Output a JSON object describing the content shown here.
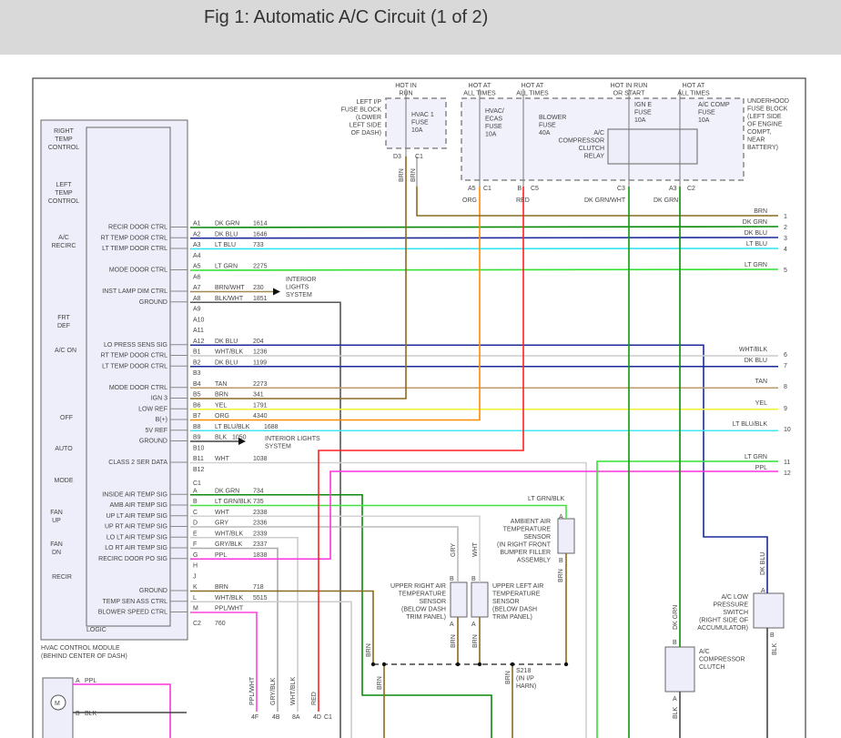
{
  "title": "Fig 1: Automatic A/C Circuit (1 of 2)",
  "wire_colors": {
    "DK GRN": "#0a8a0a",
    "DK BLU": "#1a2a9a",
    "LT BLU": "#33e4f0",
    "LT GRN": "#33e033",
    "BRN/WHT": "#a08a50",
    "BLK/WHT": "#555555",
    "WHT/BLK": "#cccccc",
    "TAN": "#b89a6a",
    "BRN": "#8a6a20",
    "YEL": "#f2f230",
    "ORG": "#ff8a00",
    "LT BLU/BLK": "#44e6f0",
    "BLK": "#444444",
    "WHT": "#d2d2d2",
    "LT GRN/BLK": "#44e044",
    "GRY": "#bbbbbb",
    "GRY/BLK": "#aaaaaa",
    "PPL": "#ff33dd",
    "PPL/WHT": "#ff44dd",
    "RED": "#ff2020",
    "DK GRN/WHT": "#0a9a0a"
  },
  "module": {
    "name": "HVAC CONTROL MODULE",
    "location": "(BEHIND CENTER OF DASH)",
    "logic_label": "LOGIC",
    "controls": [
      "RIGHT",
      "TEMP",
      "CONTROL",
      "LEFT",
      "TEMP",
      "CONTROL",
      "A/C",
      "RECIRC",
      "FRT",
      "DEF",
      "A/C ON",
      "OFF",
      "AUTO",
      "MODE",
      "FAN",
      "UP",
      "FAN",
      "DN",
      "RECIR"
    ],
    "connector_c1": "C1",
    "connector_c2": "C2",
    "c2_circuit": "760",
    "pins": [
      {
        "pin": "A1",
        "signal": "RECIR DOOR CTRL",
        "wire": "DK GRN",
        "circuit": "1614"
      },
      {
        "pin": "A2",
        "signal": "RT TEMP DOOR CTRL",
        "wire": "DK BLU",
        "circuit": "1646"
      },
      {
        "pin": "A3",
        "signal": "LT TEMP DOOR CTRL",
        "wire": "LT BLU",
        "circuit": "733"
      },
      {
        "pin": "A4",
        "signal": "",
        "wire": "",
        "circuit": ""
      },
      {
        "pin": "A5",
        "signal": "MODE DOOR CTRL",
        "wire": "LT GRN",
        "circuit": "2275"
      },
      {
        "pin": "A6",
        "signal": "",
        "wire": "",
        "circuit": ""
      },
      {
        "pin": "A7",
        "signal": "INST LAMP DIM CTRL",
        "wire": "BRN/WHT",
        "circuit": "230"
      },
      {
        "pin": "A8",
        "signal": "GROUND",
        "wire": "BLK/WHT",
        "circuit": "1851"
      },
      {
        "pin": "A9",
        "signal": "",
        "wire": "",
        "circuit": ""
      },
      {
        "pin": "A10",
        "signal": "",
        "wire": "",
        "circuit": ""
      },
      {
        "pin": "A11",
        "signal": "",
        "wire": "",
        "circuit": ""
      },
      {
        "pin": "A12",
        "signal": "LO PRESS SENS SIG",
        "wire": "DK BLU",
        "circuit": "204"
      },
      {
        "pin": "B1",
        "signal": "RT TEMP DOOR CTRL",
        "wire": "WHT/BLK",
        "circuit": "1236"
      },
      {
        "pin": "B2",
        "signal": "LT TEMP DOOR CTRL",
        "wire": "DK BLU",
        "circuit": "1199"
      },
      {
        "pin": "B3",
        "signal": "",
        "wire": "",
        "circuit": ""
      },
      {
        "pin": "B4",
        "signal": "MODE DOOR CTRL",
        "wire": "TAN",
        "circuit": "2273"
      },
      {
        "pin": "B5",
        "signal": "IGN 3",
        "wire": "BRN",
        "circuit": "341"
      },
      {
        "pin": "B6",
        "signal": "LOW REF",
        "wire": "YEL",
        "circuit": "1791"
      },
      {
        "pin": "B7",
        "signal": "B(+)",
        "wire": "ORG",
        "circuit": "4340"
      },
      {
        "pin": "B8",
        "signal": "5V REF",
        "wire": "LT BLU/BLK",
        "circuit": "1688"
      },
      {
        "pin": "B9",
        "signal": "GROUND",
        "wire": "BLK",
        "circuit": "1050"
      },
      {
        "pin": "B10",
        "signal": "",
        "wire": "",
        "circuit": ""
      },
      {
        "pin": "B11",
        "signal": "CLASS 2 SER DATA",
        "wire": "WHT",
        "circuit": "1038"
      },
      {
        "pin": "B12",
        "signal": "",
        "wire": "",
        "circuit": ""
      },
      {
        "pin": "A",
        "signal": "INSIDE AIR TEMP SIG",
        "wire": "DK GRN",
        "circuit": "734"
      },
      {
        "pin": "B",
        "signal": "AMB AIR TEMP SIG",
        "wire": "LT GRN/BLK",
        "circuit": "735"
      },
      {
        "pin": "C",
        "signal": "UP LT AIR TEMP SIG",
        "wire": "WHT",
        "circuit": "2338"
      },
      {
        "pin": "D",
        "signal": "UP RT AIR TEMP SIG",
        "wire": "GRY",
        "circuit": "2336"
      },
      {
        "pin": "E",
        "signal": "LO LT AIR TEMP SIG",
        "wire": "WHT/BLK",
        "circuit": "2339"
      },
      {
        "pin": "F",
        "signal": "LO RT AIR TEMP SIG",
        "wire": "GRY/BLK",
        "circuit": "2337"
      },
      {
        "pin": "G",
        "signal": "RECIRC DOOR PO SIG",
        "wire": "PPL",
        "circuit": "1838"
      },
      {
        "pin": "H",
        "signal": "",
        "wire": "",
        "circuit": ""
      },
      {
        "pin": "J",
        "signal": "",
        "wire": "",
        "circuit": ""
      },
      {
        "pin": "K",
        "signal": "GROUND",
        "wire": "BRN",
        "circuit": "718"
      },
      {
        "pin": "L",
        "signal": "TEMP SEN ASS CTRL",
        "wire": "WHT/BLK",
        "circuit": "5515"
      },
      {
        "pin": "M",
        "signal": "BLOWER SPEED CTRL",
        "wire": "PPL/WHT",
        "circuit": ""
      }
    ]
  },
  "interior_lights": "INTERIOR LIGHTS SYSTEM",
  "interior_lights_lines": [
    "INTERIOR",
    "LIGHTS",
    "SYSTEM"
  ],
  "interior_lights_b9": [
    "INTERIOR LIGHTS",
    "SYSTEM"
  ],
  "outputs": [
    {
      "num": "1",
      "wire": "BRN"
    },
    {
      "num": "2",
      "wire": "DK GRN"
    },
    {
      "num": "3",
      "wire": "DK BLU"
    },
    {
      "num": "4",
      "wire": "LT BLU"
    },
    {
      "num": "5",
      "wire": "LT GRN"
    },
    {
      "num": "6",
      "wire": "WHT/BLK"
    },
    {
      "num": "7",
      "wire": "DK BLU"
    },
    {
      "num": "8",
      "wire": "TAN"
    },
    {
      "num": "9",
      "wire": "YEL"
    },
    {
      "num": "10",
      "wire": "LT BLU/BLK"
    },
    {
      "num": "11",
      "wire": "LT GRN"
    },
    {
      "num": "12",
      "wire": "PPL"
    }
  ],
  "fuses": {
    "left_block": [
      "LEFT I/P",
      "FUSE BLOCK",
      "(LOWER",
      "LEFT SIDE",
      "OF DASH)"
    ],
    "hvac1": {
      "hot": [
        "HOT IN",
        "RUN"
      ],
      "name": [
        "HVAC 1",
        "FUSE",
        "10A"
      ],
      "pins": [
        "D3",
        "C1"
      ],
      "wires": [
        "BRN",
        "BRN"
      ]
    },
    "hvac_ecas": {
      "hot": [
        "HOT AT",
        "ALL TIMES"
      ],
      "name": [
        "HVAC/",
        "ECAS",
        "FUSE",
        "10A"
      ],
      "pins": [
        "A5",
        "C1"
      ],
      "wire": "ORG"
    },
    "blower": {
      "hot": [
        "HOT AT",
        "ALL TIMES"
      ],
      "name": [
        "BLOWER",
        "FUSE",
        "40A"
      ],
      "pins": [
        "B",
        "C5"
      ],
      "wire": "RED"
    },
    "ign_e": {
      "hot": [
        "HOT IN RUN",
        "OR START"
      ],
      "name": [
        "IGN E",
        "FUSE",
        "10A"
      ],
      "pins": [
        "C3"
      ],
      "wire": "DK GRN/WHT"
    },
    "ac_comp": {
      "hot": [
        "HOT AT",
        "ALL TIMES"
      ],
      "name": [
        "A/C COMP",
        "FUSE",
        "10A"
      ],
      "pins": [
        "A3",
        "C2"
      ],
      "wire": "DK GRN"
    },
    "relay": [
      "A/C",
      "COMPRESSOR",
      "CLUTCH",
      "RELAY"
    ],
    "underhood_block": [
      "UNDERHOOD",
      "FUSE BLOCK",
      "(LEFT SIDE",
      "OF ENGINE",
      "COMPT,",
      "NEAR",
      "BATTERY)"
    ]
  },
  "components": {
    "ambient": {
      "label": [
        "AMBIENT AIR",
        "TEMPERATURE",
        "SENSOR",
        "(IN RIGHT FRONT",
        "BUMPER FILLER",
        "ASSEMBLY"
      ],
      "wire_in": "LT GRN/BLK",
      "wire_out": "BRN",
      "pins": [
        "A",
        "B"
      ]
    },
    "upper_right": {
      "label": [
        "UPPER RIGHT AIR",
        "TEMPERATURE",
        "SENSOR",
        "(BELOW DASH",
        "TRIM PANEL)"
      ],
      "wire_in": "GRY",
      "wire_out": "BRN",
      "pins": [
        "B",
        "A"
      ]
    },
    "upper_left": {
      "label": [
        "UPPER LEFT AIR",
        "TEMPERATURE",
        "SENSOR",
        "(BELOW DASH",
        "TRIM PANEL)"
      ],
      "wire_in": "WHT",
      "wire_out": "BRN",
      "pins": [
        "B",
        "A"
      ]
    },
    "splice": [
      "S218",
      "(IN I/P",
      "HARN)"
    ],
    "splice_wires": [
      "BRN",
      "BRN",
      "BRN"
    ],
    "low_pressure": {
      "label": [
        "A/C LOW",
        "PRESSURE",
        "SWITCH",
        "(RIGHT SIDE OF",
        "ACCUMULATOR)"
      ],
      "wire_in": "DK BLU",
      "wire_out": "BLK",
      "pins": [
        "A",
        "B"
      ]
    },
    "clutch": {
      "label": [
        "A/C",
        "COMPRESSOR",
        "CLUTCH"
      ],
      "wire_in": "DK GRN",
      "wire_out": "BLK",
      "pins": [
        "B",
        "A"
      ]
    },
    "blower_motor": {
      "pins": [
        "A",
        "B"
      ],
      "wires": [
        "PPL",
        "BLK"
      ]
    },
    "bottom_connectors": [
      {
        "pin": "4F",
        "wire": "PPL/WHT"
      },
      {
        "pin": "4B",
        "wire": "GRY/BLK"
      },
      {
        "pin": "8A",
        "wire": "WHT/BLK"
      },
      {
        "pin": "4D",
        "wire": "RED"
      },
      {
        "pin": "C1",
        "wire": ""
      }
    ]
  }
}
